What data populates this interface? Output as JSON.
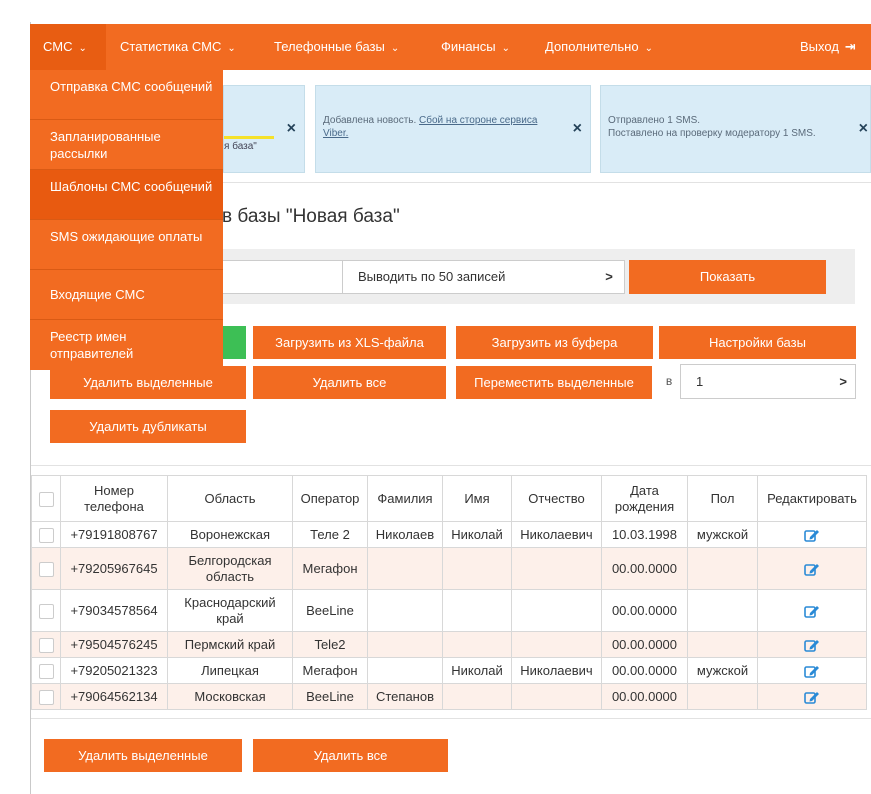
{
  "nav": {
    "sms": "СМС",
    "stats": "Статистика СМС",
    "phone_bases": "Телефонные базы",
    "finance": "Финансы",
    "more": "Дополнительно",
    "logout": "Выход"
  },
  "dropdown": {
    "send": "Отправка СМС сообщений",
    "scheduled": "Запланированные рассылки",
    "templates": "Шаблоны СМС сообщений",
    "awaiting": "SMS ожидающие оплаты",
    "incoming": "Входящие СМС",
    "senders": "Реестр имен отправителей"
  },
  "notifications": {
    "n1_text": "я база\"",
    "n2_text": "Добавлена новость.",
    "n2_link": "Сбой на стороне сервиса Viber.",
    "n3_line1": "Отправлено 1 SMS.",
    "n3_line2": "Поставлено на проверку модератору 1 SMS.",
    "close": "×"
  },
  "page_title": "в базы \"Новая база\"",
  "filter": {
    "per_page": "Выводить по 50 записей",
    "arrow": ">",
    "show": "Показать"
  },
  "buttons": {
    "load_xls": "Загрузить из XLS-файла",
    "load_buffer": "Загрузить из буфера",
    "base_settings": "Настройки базы",
    "delete_selected": "Удалить выделенные",
    "delete_all": "Удалить все",
    "move_selected": "Переместить выделенные",
    "move_in": "в",
    "move_target": "1",
    "move_arrow": ">",
    "delete_duplicates": "Удалить дубликаты",
    "bottom_delete_selected": "Удалить выделенные",
    "bottom_delete_all": "Удалить все"
  },
  "table": {
    "headers": [
      "Номер телефона",
      "Область",
      "Оператор",
      "Фамилия",
      "Имя",
      "Отчество",
      "Дата рождения",
      "Пол",
      "Редактировать"
    ],
    "rows": [
      [
        "+79191808767",
        "Воронежская",
        "Теле 2",
        "Николаев",
        "Николай",
        "Николаевич",
        "10.03.1998",
        "мужской"
      ],
      [
        "+79205967645",
        "Белгородская область",
        "Мегафон",
        "",
        "",
        "",
        "00.00.0000",
        ""
      ],
      [
        "+79034578564",
        "Краснодарский край",
        "BeeLine",
        "",
        "",
        "",
        "00.00.0000",
        ""
      ],
      [
        "+79504576245",
        "Пермский край",
        "Tele2",
        "",
        "",
        "",
        "00.00.0000",
        ""
      ],
      [
        "+79205021323",
        "Липецкая",
        "Мегафон",
        "",
        "Николай",
        "Николаевич",
        "00.00.0000",
        "мужской"
      ],
      [
        "+79064562134",
        "Московская",
        "BeeLine",
        "Степанов",
        "",
        "",
        "00.00.0000",
        ""
      ]
    ]
  },
  "colors": {
    "accent": "#f26b21",
    "accent_dark": "#e85a10",
    "notice_bg": "#d9ecf7",
    "row_tint": "#fdf0ea",
    "edit_icon": "#2a8ad6"
  },
  "icons": {
    "chevron": "chevron-down-icon",
    "logout": "logout-icon",
    "close": "close-icon",
    "edit": "edit-icon"
  }
}
